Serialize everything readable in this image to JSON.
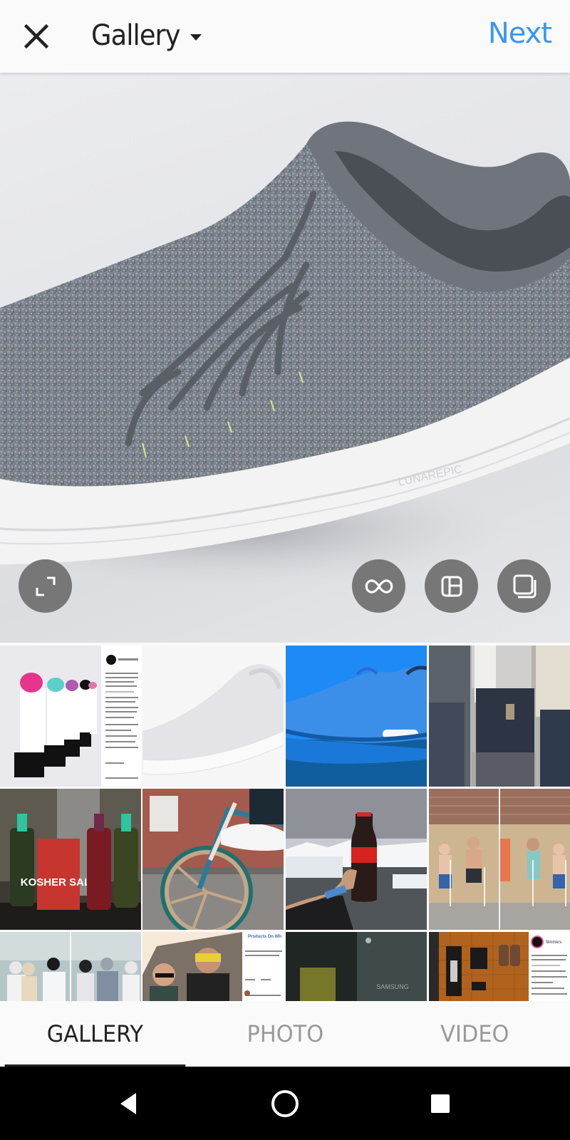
{
  "header": {
    "close_icon": "close-icon",
    "title": "Gallery",
    "dropdown_icon": "caret-down-icon",
    "next_label": "Next"
  },
  "preview": {
    "image_description": "Grey knit running shoe with multicolor flecks on light grey background",
    "sole_text": "LUNAREPIC",
    "buttons": [
      {
        "name": "expand-crop-button",
        "icon": "expand-icon"
      },
      {
        "name": "boomerang-button",
        "icon": "infinity-icon"
      },
      {
        "name": "layout-button",
        "icon": "layout-icon"
      },
      {
        "name": "select-multiple-button",
        "icon": "multiple-select-icon"
      }
    ]
  },
  "gallery": {
    "thumbnails": [
      {
        "description": "Lipsticks in a row with Instagram post screenshot",
        "post_user": "maccosmetics",
        "likes": "121,892 likes"
      },
      {
        "description": "White knit sneaker on white background"
      },
      {
        "description": "Blue Air Max sneaker on blue background"
      },
      {
        "description": "People wearing jeans standing side by side"
      },
      {
        "description": "Bottles and Kosher salt box on bar",
        "label": "KOSHER SALT"
      },
      {
        "description": "BMX bike with white sneaker on pedal"
      },
      {
        "description": "Hand holding Coca-Cola bottle over glacier lagoon"
      },
      {
        "description": "Kids playing in fountain, split image"
      },
      {
        "description": "Pedestrians crossing street in city, split image"
      },
      {
        "description": "Men wearing VR glasses with Facebook post",
        "post_page": "Products On Wh",
        "post_text": "Jeff and Paul modeling the fashion. Show us your gla"
      },
      {
        "description": "Blurred shirt and Samsung device",
        "label": "SAMSUNG"
      },
      {
        "description": "Camera gear flat lay on wooden floor with Instagram post",
        "post_user": "filmmkrs"
      }
    ]
  },
  "tabs": [
    {
      "label": "GALLERY",
      "active": true
    },
    {
      "label": "PHOTO",
      "active": false
    },
    {
      "label": "VIDEO",
      "active": false
    }
  ],
  "navbar": {
    "back_icon": "back-icon",
    "home_icon": "home-icon",
    "recents_icon": "recents-icon"
  },
  "colors": {
    "accent": "#3897f0",
    "text": "#222222",
    "inactive_tab": "#999999",
    "button_bg": "#777777"
  }
}
